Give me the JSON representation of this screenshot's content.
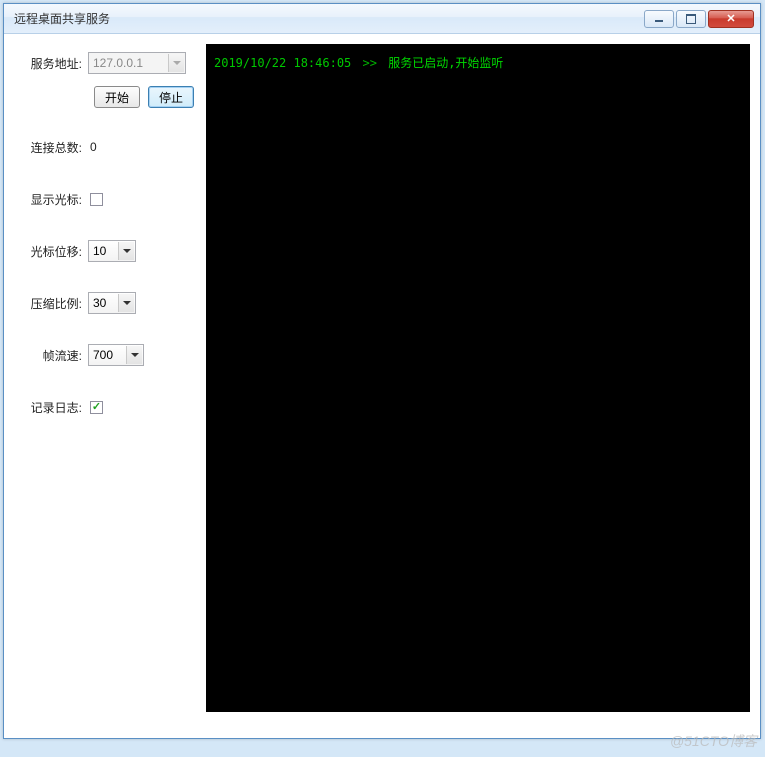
{
  "window": {
    "title": "远程桌面共享服务"
  },
  "form": {
    "service_addr_label": "服务地址:",
    "service_addr_value": "127.0.0.1",
    "start_label": "开始",
    "stop_label": "停止",
    "conn_total_label": "连接总数:",
    "conn_total_value": "0",
    "show_cursor_label": "显示光标:",
    "show_cursor_checked": false,
    "cursor_offset_label": "光标位移:",
    "cursor_offset_value": "10",
    "compress_label": "压缩比例:",
    "compress_value": "30",
    "fps_label": "帧流速:",
    "fps_value": "700",
    "log_label": "记录日志:",
    "log_checked": true
  },
  "console": {
    "lines": [
      {
        "ts": "2019/10/22 18:46:05",
        "sep": ">>",
        "msg": "服务已启动,开始监听"
      }
    ]
  },
  "watermark": "@51CTO博客"
}
